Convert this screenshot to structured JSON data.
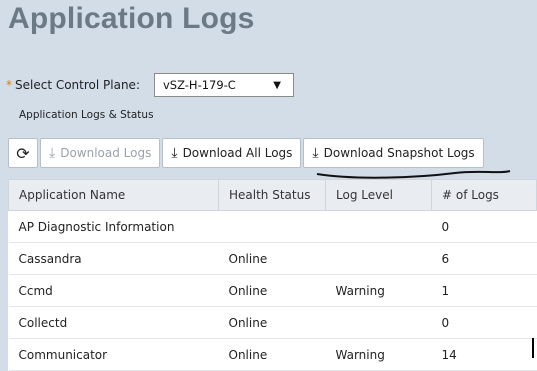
{
  "page": {
    "title": "Application Logs"
  },
  "control_plane": {
    "required_marker": "*",
    "label": "Select Control Plane:",
    "selected": "vSZ-H-179-C",
    "dropdown_icon": "triangle-down"
  },
  "section": {
    "subheading": "Application Logs & Status"
  },
  "toolbar": {
    "refresh_icon": "refresh",
    "download_logs": "Download Logs",
    "download_all_logs": "Download All Logs",
    "download_snapshot_logs": "Download Snapshot Logs",
    "download_icon": "download"
  },
  "table": {
    "columns": [
      "Application Name",
      "Health Status",
      "Log Level",
      "# of Logs"
    ],
    "rows": [
      {
        "name": "AP Diagnostic Information",
        "health": "",
        "level": "",
        "count": "0"
      },
      {
        "name": "Cassandra",
        "health": "Online",
        "level": "",
        "count": "6"
      },
      {
        "name": "Ccmd",
        "health": "Online",
        "level": "Warning",
        "count": "1"
      },
      {
        "name": "Collectd",
        "health": "Online",
        "level": "",
        "count": "0"
      },
      {
        "name": "Communicator",
        "health": "Online",
        "level": "Warning",
        "count": "14"
      }
    ]
  },
  "colors": {
    "online": "#1f8a1f",
    "link_count": "#1c4fa0",
    "title": "#6c7a86"
  }
}
